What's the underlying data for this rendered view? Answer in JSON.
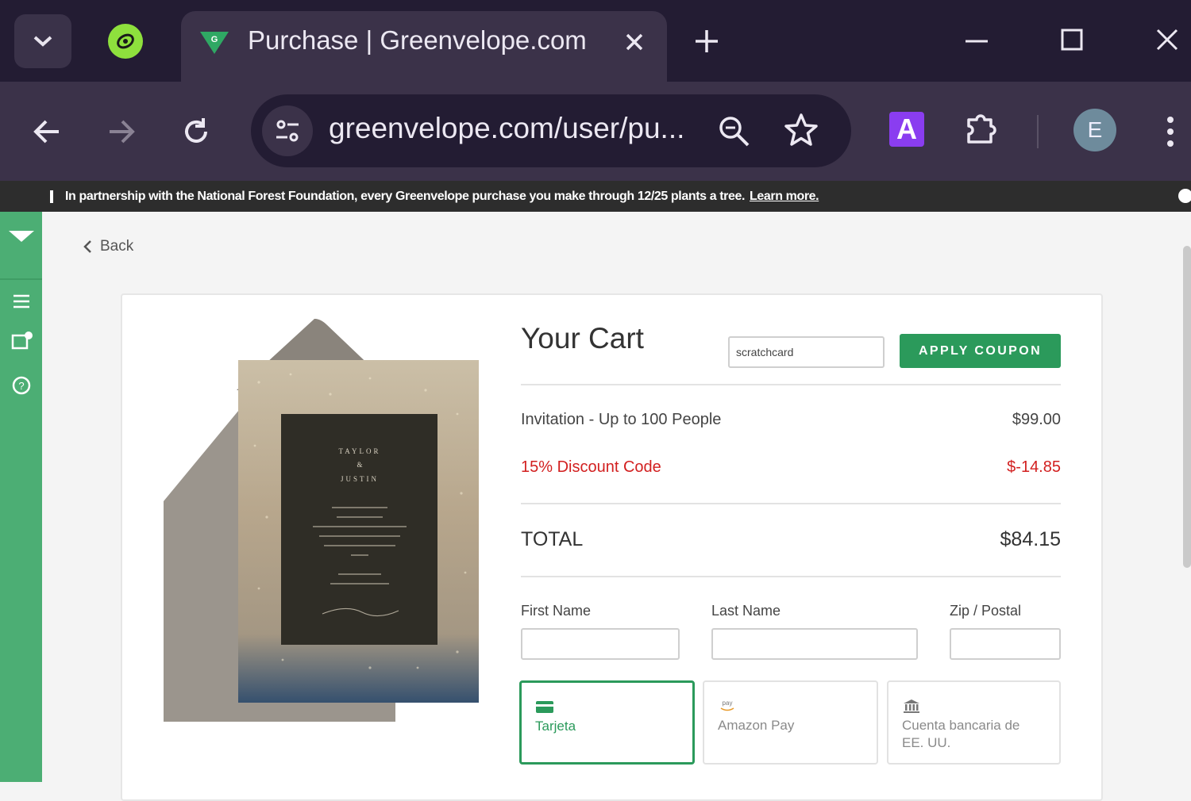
{
  "browser": {
    "tab_title": "Purchase | Greenvelope.com",
    "url": "greenvelope.com/user/pu...",
    "profile_initial": "E",
    "extension_letter": "A"
  },
  "announcement": {
    "text": "In partnership with the National Forest Foundation, every Greenvelope purchase you make through 12/25 plants a tree.",
    "link": "Learn more."
  },
  "page": {
    "back_label": "Back"
  },
  "cart": {
    "title": "Your Cart",
    "coupon_value": "scratchcard",
    "apply_label": "APPLY COUPON",
    "items": [
      {
        "label": "Invitation - Up to 100 People",
        "amount": "$99.00"
      },
      {
        "label": "15% Discount Code",
        "amount": "$-14.85"
      }
    ],
    "total_label": "TOTAL",
    "total_amount": "$84.15"
  },
  "form": {
    "first_name_label": "First Name",
    "last_name_label": "Last Name",
    "zip_label": "Zip / Postal"
  },
  "payment": {
    "options": [
      {
        "label": "Tarjeta",
        "icon": "card-icon",
        "selected": true
      },
      {
        "label": "Amazon Pay",
        "icon": "amazon-pay-icon",
        "selected": false
      },
      {
        "label": "Cuenta bancaria de EE. UU.",
        "icon": "bank-icon",
        "selected": false
      }
    ]
  },
  "invitation": {
    "name1": "TAYLOR",
    "amp": "&",
    "name2": "JUSTIN"
  },
  "colors": {
    "brand_green": "#2b9a5b",
    "sidebar_green": "#4cae74",
    "discount_red": "#d21f1f",
    "chrome_dark": "#231c33"
  }
}
